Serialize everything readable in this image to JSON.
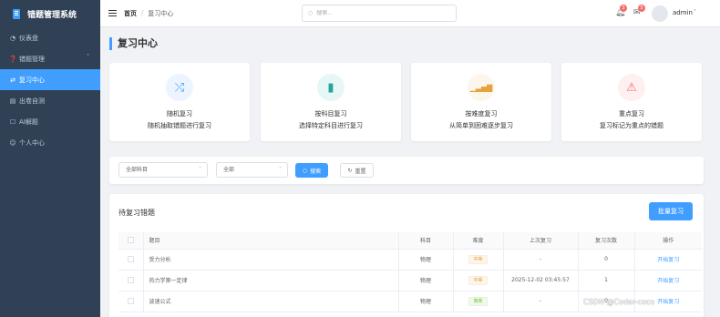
{
  "app": {
    "title": "错题管理系统"
  },
  "sidebar": {
    "items": [
      {
        "icon": "dashboard-icon",
        "glyph": "◔",
        "label": "仪表盘"
      },
      {
        "icon": "question-icon",
        "glyph": "❓",
        "label": "错题管理",
        "arrow": "˅"
      },
      {
        "icon": "shuffle-icon",
        "glyph": "⇄",
        "label": "复习中心",
        "active": true
      },
      {
        "icon": "document-icon",
        "glyph": "▤",
        "label": "出卷自测"
      },
      {
        "icon": "robot-icon",
        "glyph": "☐",
        "label": "AI解题"
      },
      {
        "icon": "user-icon",
        "glyph": "☺",
        "label": "个人中心"
      }
    ]
  },
  "header": {
    "breadcrumb": [
      "首页",
      "复习中心"
    ],
    "search_placeholder": "搜索...",
    "notifications": {
      "icon": "bell-icon",
      "count": "3"
    },
    "messages": {
      "icon": "mail-icon",
      "count": "5"
    },
    "user": {
      "name": "admin"
    }
  },
  "page": {
    "title": "复习中心"
  },
  "cards": [
    {
      "icon": "shuffle-icon",
      "glyph": "⤭",
      "color": "#409eff",
      "bg": "#ecf5ff",
      "title": "随机复习",
      "desc": "随机抽取错题进行复习"
    },
    {
      "icon": "book-icon",
      "glyph": "▮",
      "color": "#26a69a",
      "bg": "#e6f7f5",
      "title": "按科目复习",
      "desc": "选择特定科目进行复习"
    },
    {
      "icon": "signal-bars-icon",
      "glyph": "▁▃▅▇",
      "color": "#e6a23c",
      "bg": "#fdf6ec",
      "title": "按难度复习",
      "desc": "从简单到困难逐步复习"
    },
    {
      "icon": "warning-icon",
      "glyph": "⚠",
      "color": "#f56c6c",
      "bg": "#fef0f0",
      "title": "重点复习",
      "desc": "复习标记为重点的错题"
    }
  ],
  "filter": {
    "subject": "全部科目",
    "difficulty": "全部",
    "search_button": "搜索",
    "reset_button": "重置"
  },
  "list": {
    "title": "待复习错题",
    "batch_button": "批量复习",
    "columns": [
      "题目",
      "科目",
      "难度",
      "上次复习",
      "复习次数",
      "操作"
    ],
    "rows": [
      {
        "title": "受力分析",
        "subject": "物理",
        "difficulty": "中等",
        "level": "mid",
        "last": "-",
        "count": "0",
        "action": "开始复习"
      },
      {
        "title": "热力学第一定律",
        "subject": "物理",
        "difficulty": "中等",
        "level": "mid",
        "last": "2025-12-02 03:45:57",
        "count": "1",
        "action": "开始复习"
      },
      {
        "title": "波速公式",
        "subject": "物理",
        "difficulty": "简单",
        "level": "easy",
        "last": "-",
        "count": "0",
        "action": "开始复习"
      }
    ]
  },
  "watermark": "CSDN @Coder-coco"
}
